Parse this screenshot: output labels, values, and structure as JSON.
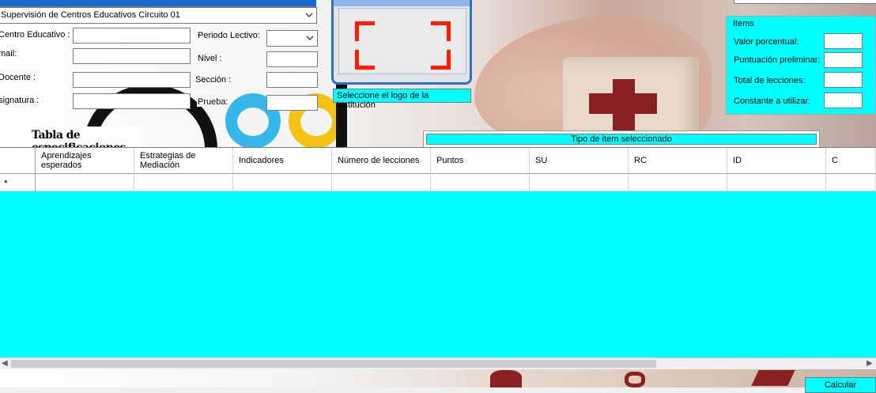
{
  "header": {
    "supervision_value": "Supervisión de Centros Educativos Circuito 01",
    "top_strip_text": ""
  },
  "form": {
    "centro_label": "Centro Educativo :",
    "email_label": "mail:",
    "docente_label": "Docente :",
    "asignatura_label": "signatura :",
    "periodo_label": "Periodo Lectivo:",
    "nivel_label": "Nivel :",
    "seccion_label": "Sección :",
    "prueba_label": "Prueba:",
    "centro_value": "",
    "email_value": "",
    "docente_value": "",
    "asignatura_value": "",
    "periodo_value": "",
    "nivel_value": "",
    "seccion_value": "",
    "prueba_value": ""
  },
  "logo_picker": {
    "label": "Seleccione el logo de la institución"
  },
  "items_panel": {
    "legend": "Items",
    "rows": [
      {
        "label": "Valor porcentual:",
        "value": ""
      },
      {
        "label": "Puntuación preliminar:",
        "value": ""
      },
      {
        "label": "Total de lecciones:",
        "value": ""
      },
      {
        "label": "Constante a utilizar:",
        "value": ""
      }
    ]
  },
  "table": {
    "title": "Tabla de especificaciones",
    "tipo_label": "Tipo de item seleccionado",
    "columns": [
      "Aprendizajes esperados",
      "Estrategias de Mediación",
      "Indicadores",
      "Número de lecciones",
      "Puntos",
      "SU",
      "RC",
      "ID",
      "C"
    ],
    "new_row_marker": "*"
  },
  "actions": {
    "calcular_label": "Calcular"
  },
  "colors": {
    "accent": "#00ffff",
    "picker_border": "#2f6fc7",
    "corner_red": "#ff1a00"
  }
}
